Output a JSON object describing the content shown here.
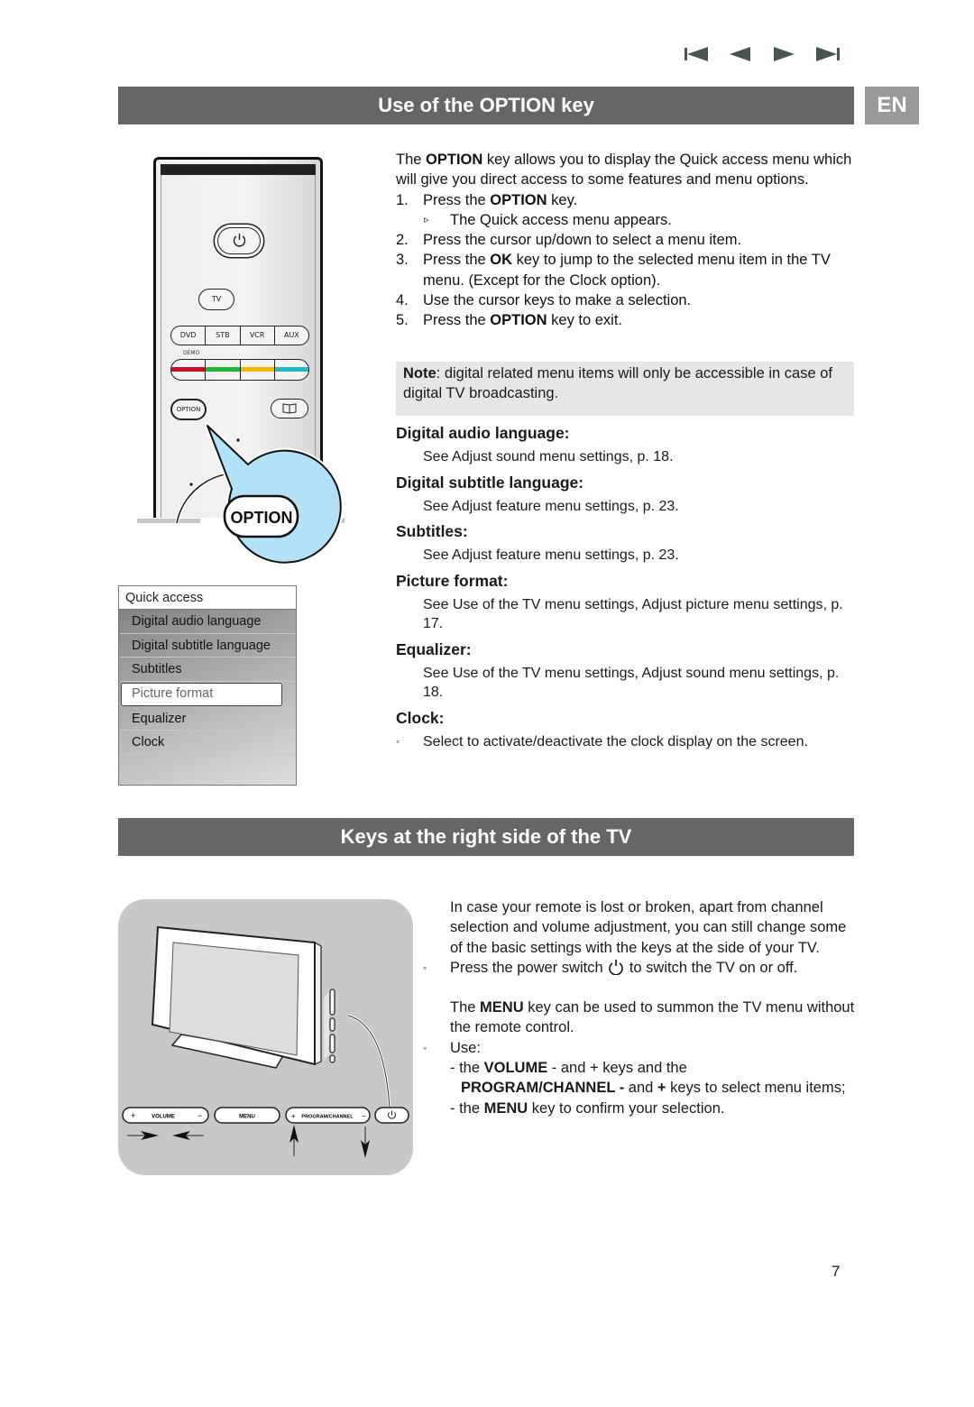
{
  "nav": {
    "icons": [
      "first-page-icon",
      "previous-page-icon",
      "next-page-icon",
      "last-page-icon"
    ]
  },
  "language_badge": "EN",
  "section1": {
    "title": "Use of the OPTION key",
    "intro_pre": "The ",
    "intro_bold": "OPTION",
    "intro_post": " key allows you to display the Quick access menu which will give you direct access to some features and menu options.",
    "steps": [
      {
        "num": "1.",
        "pre": "Press the ",
        "bold": "OPTION",
        "post": " key."
      },
      {
        "num": "▹",
        "pre": "The Quick access menu appears.",
        "bold": "",
        "post": ""
      },
      {
        "num": "2.",
        "pre": "Press the cursor up/down to select a menu item.",
        "bold": "",
        "post": ""
      },
      {
        "num": "3.",
        "pre": "Press the ",
        "bold": "OK",
        "post": " key to jump to the selected menu item in the TV menu. (Except for the Clock option)."
      },
      {
        "num": "4.",
        "pre": "Use the cursor keys to make a selection.",
        "bold": "",
        "post": ""
      },
      {
        "num": "5.",
        "pre": "Press the ",
        "bold": "OPTION",
        "post": " key to exit."
      }
    ],
    "note_bold": "Note",
    "note_text": ": digital related menu items will only be accessible in case of digital TV broadcasting.",
    "definitions": [
      {
        "term": "Digital audio language:",
        "desc": "See Adjust sound menu settings, p. 18."
      },
      {
        "term": "Digital subtitle language:",
        "desc": "See Adjust feature menu settings, p. 23."
      },
      {
        "term": "Subtitles:",
        "desc": "See Adjust feature menu settings, p. 23."
      },
      {
        "term": "Picture format:",
        "desc": "See Use of the TV menu settings, Adjust picture menu settings, p. 17."
      },
      {
        "term": "Equalizer:",
        "desc": "See Use of the TV menu settings, Adjust sound menu settings, p. 18."
      },
      {
        "term": "Clock:",
        "desc": "Select to activate/deactivate the clock display on the screen.",
        "bullet": "◦"
      }
    ]
  },
  "remote": {
    "tv_label": "TV",
    "source_buttons": [
      "DVD",
      "STB",
      "VCR",
      "AUX"
    ],
    "demo_label": "DEMO",
    "color_keys": [
      "#c8102e",
      "#1db83a",
      "#f5b800",
      "#22b8c8"
    ],
    "option_label": "OPTION",
    "callout_label": "OPTION",
    "callout_color": "#b3e1f7"
  },
  "quick_access": {
    "title": "Quick access",
    "items": [
      "Digital audio language",
      "Digital subtitle language",
      "Subtitles",
      "Picture format",
      "Equalizer",
      "Clock"
    ],
    "selected_index": 3
  },
  "section2": {
    "title": "Keys at the right side of the TV",
    "intro": "In case your remote is lost or broken, apart from channel selection and volume adjustment, you can still change some of the basic settings with the keys at the side of your TV.",
    "bullet1_pre": "Press the power switch ",
    "bullet1_post": " to switch the TV on or off.",
    "menu_pre": "The ",
    "menu_bold": "MENU",
    "menu_post": " key can be used to summon the TV menu without the remote control.",
    "use_label": "Use:",
    "dash1_pre": "- the ",
    "dash1_bold": "VOLUME",
    "dash1_post": " - and + keys and the",
    "dash1b_bold": "PROGRAM/CHANNEL -",
    "dash1b_mid": " and ",
    "dash1b_bold2": "+",
    "dash1b_post": "  keys to select menu items;",
    "dash2_pre": "- the ",
    "dash2_bold": "MENU",
    "dash2_post": " key to confirm your selection.",
    "bullet": "◦",
    "tv_keys": {
      "volume": "VOLUME",
      "menu": "MENU",
      "program": "PROGRAM/CHANNEL",
      "plus": "+",
      "minus": "−"
    }
  },
  "page_number": "7"
}
